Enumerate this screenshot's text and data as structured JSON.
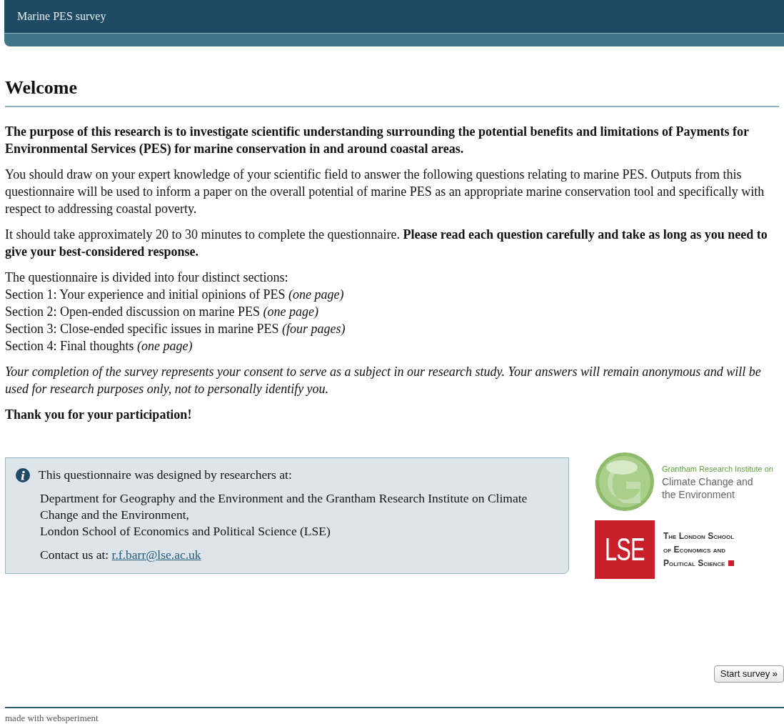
{
  "header": {
    "title": "Marine PES survey"
  },
  "heading": "Welcome",
  "paragraphs": [
    {
      "kind": "bold",
      "text": "The purpose of this research is to investigate scientific understanding surrounding the potential benefits and limitations of Payments for Environmental Services (PES) for marine conservation in and around coastal areas."
    },
    {
      "kind": "plain",
      "text": "You should draw on your expert knowledge of your scientific field to answer the following questions relating to marine PES. Outputs from this questionnaire will be used to inform a paper on the overall potential of marine PES as an appropriate marine conservation tool and specifically with respect to addressing coastal poverty."
    },
    {
      "kind": "plain",
      "text": "It should take approximately 20 to 30 minutes to complete the questionnaire. **Please read each question carefully and take as long as you need to give your best-considered response.**"
    },
    {
      "kind": "lines",
      "lines": [
        "The questionnaire is divided into four distinct sections:",
        "Section 1: Your experience and initial opinions of PES *(one page)*",
        "Section 2: Open-ended discussion on marine PES *(one page)*",
        "Section 3: Close-ended specific issues in marine PES *(four pages)*",
        "Section 4: Final thoughts *(one page)*"
      ]
    },
    {
      "kind": "italic",
      "text": "Your completion of the survey represents your consent to serve as a subject in our research study. Your answers will remain anonymous and will be used for research purposes only, not to personally identify you."
    },
    {
      "kind": "bold",
      "text": "Thank you for your participation!"
    }
  ],
  "info_box": {
    "intro": "This questionnaire was designed by researchers at:",
    "address_lines": [
      "Department for Geography and the Environment and the Grantham Research Institute on Climate Change and the Environment,",
      "London School of Economics and Political Science (LSE)"
    ],
    "contact_label": "Contact us at:",
    "contact_email": "r.f.barr@lse.ac.uk"
  },
  "logos": {
    "grantham": {
      "line_1": "Grantham Research Institute on",
      "line_2": "Climate Change and",
      "line_3": "the Environment"
    },
    "lse": {
      "mark": "LSE",
      "line_1": "The London School",
      "line_2": "of Economics and",
      "line_3": "Political Science"
    }
  },
  "start_button": "Start survey »",
  "footer": "made with websperiment"
}
